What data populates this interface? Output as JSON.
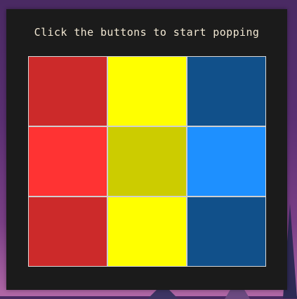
{
  "title": "Click the buttons to start popping",
  "tiles": [
    {
      "color": "#cc2a2a"
    },
    {
      "color": "#ffff00"
    },
    {
      "color": "#11508a"
    },
    {
      "color": "#ff3333"
    },
    {
      "color": "#cccc00"
    },
    {
      "color": "#1e90ff"
    },
    {
      "color": "#cc2a2a"
    },
    {
      "color": "#ffff00"
    },
    {
      "color": "#11508a"
    }
  ]
}
